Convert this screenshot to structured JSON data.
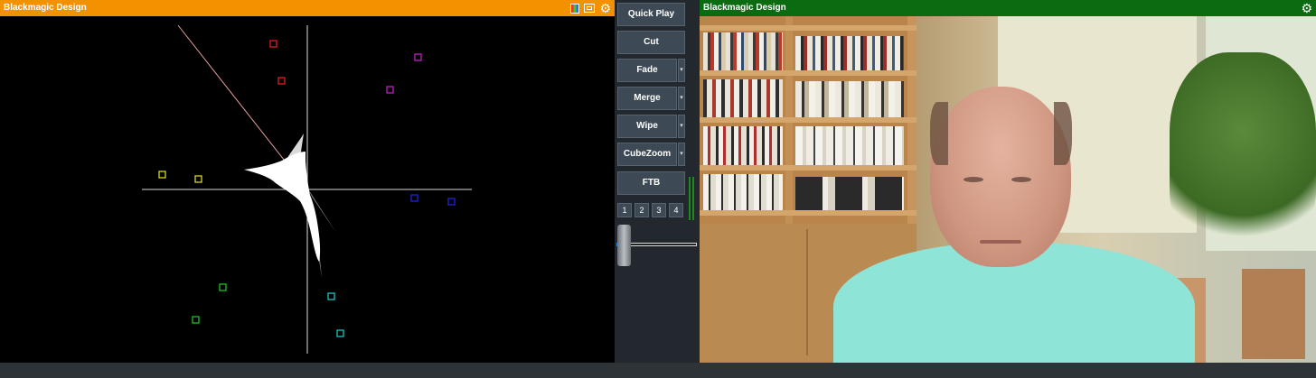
{
  "scope_panel": {
    "title": "Blackmagic Design",
    "icons": [
      "rgb-parade-icon",
      "monitor-icon",
      "gear-icon"
    ],
    "accent": "#f39100",
    "target_colors": {
      "red": "#e0201b",
      "magenta": "#c21bc2",
      "yellow": "#d8d81b",
      "blue": "#2323d8",
      "green": "#1bc21b",
      "cyan": "#1bc2c2"
    }
  },
  "controls": {
    "quick_play": "Quick Play",
    "cut": "Cut",
    "fade": "Fade",
    "merge": "Merge",
    "wipe": "Wipe",
    "cubezoom": "CubeZoom",
    "ftb": "FTB",
    "numbers": [
      "1",
      "2",
      "3",
      "4"
    ],
    "tbar_position": 0.0
  },
  "video_panel": {
    "title": "Blackmagic Design",
    "icons": [
      "gear-icon"
    ],
    "accent": "#0b6b10"
  }
}
